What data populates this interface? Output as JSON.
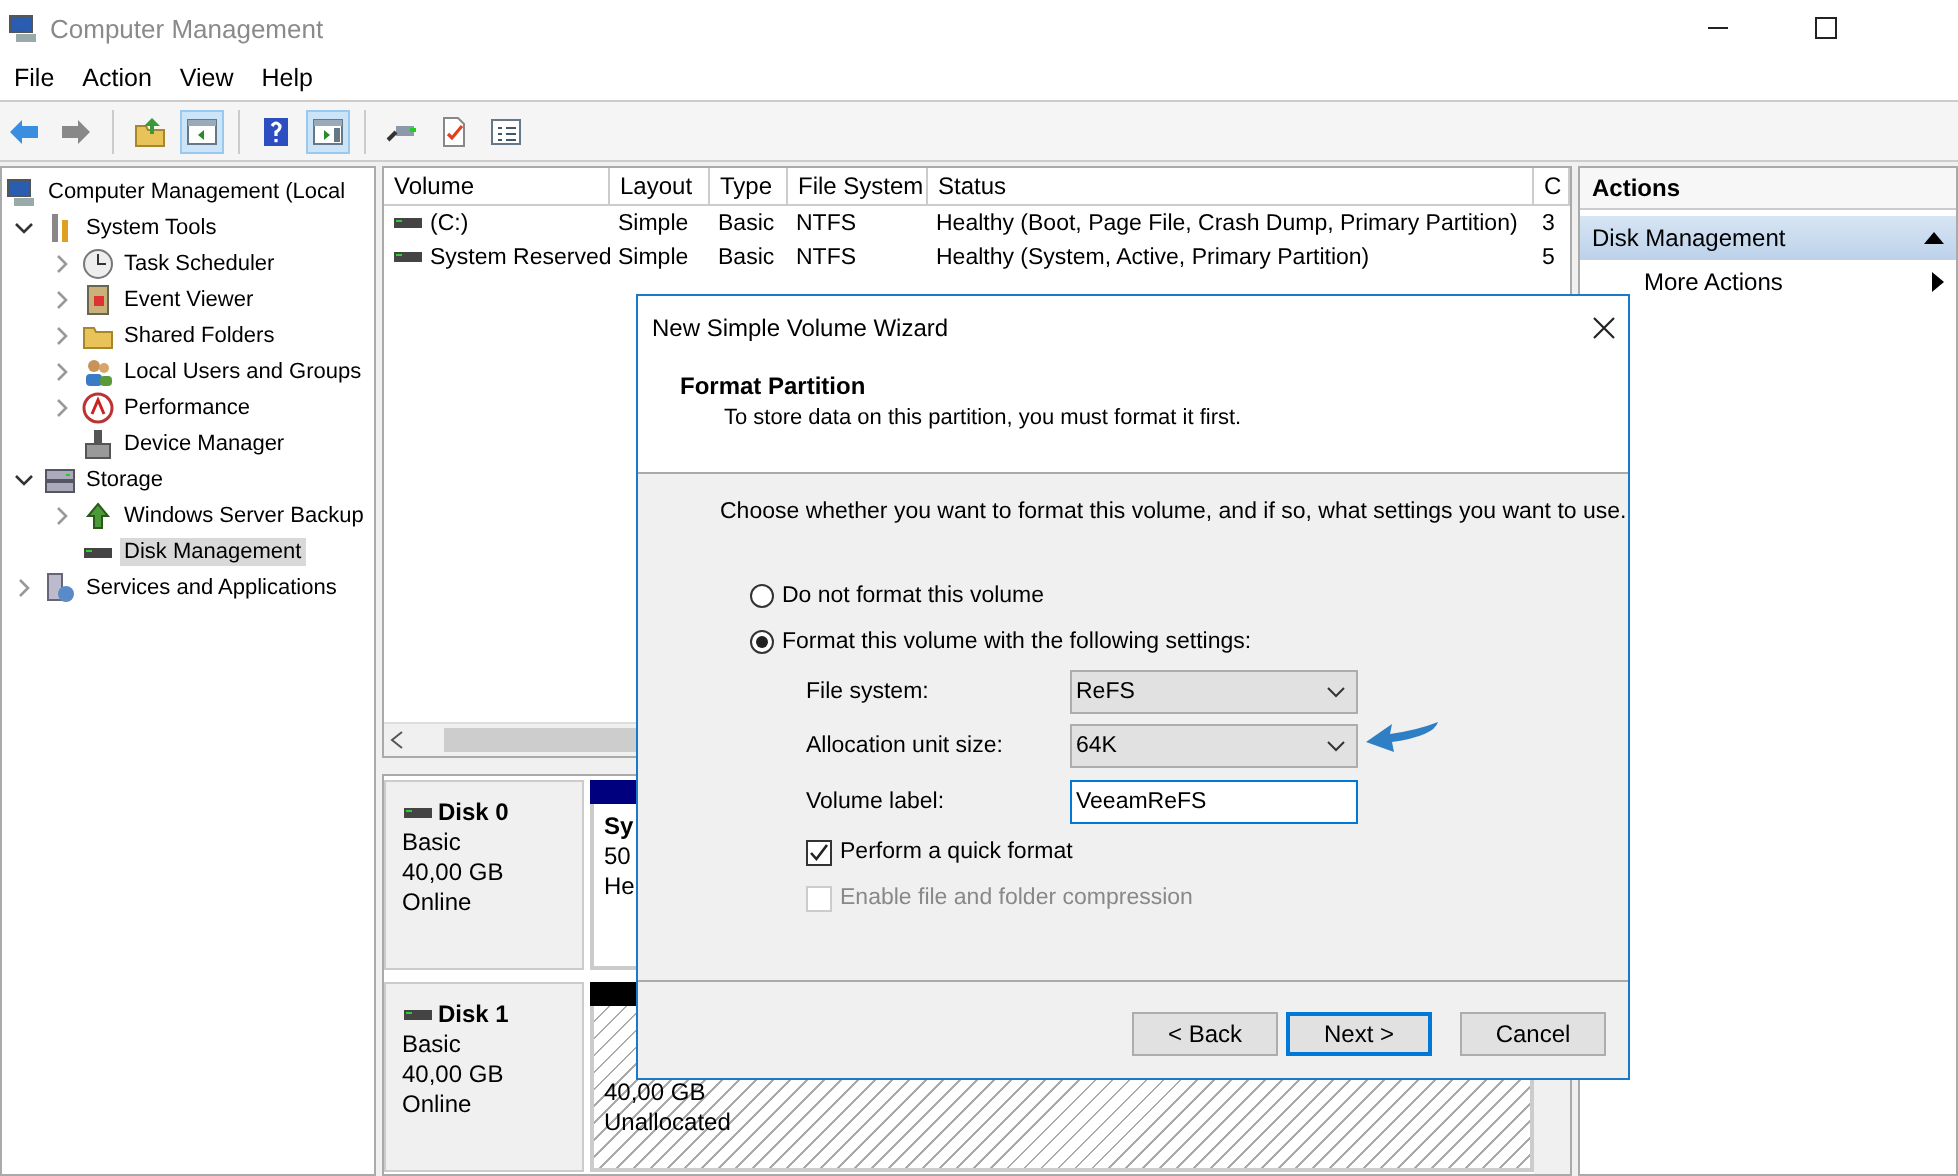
{
  "window": {
    "title": "Computer Management"
  },
  "menu": [
    "File",
    "Action",
    "View",
    "Help"
  ],
  "tree": [
    {
      "label": "Computer Management (Local",
      "selected": false,
      "children": [
        {
          "label": "System Tools",
          "expanded": true,
          "selected": false,
          "children": [
            {
              "label": "Task Scheduler",
              "expanded": false,
              "selected": false
            },
            {
              "label": "Event Viewer",
              "expanded": false,
              "selected": false
            },
            {
              "label": "Shared Folders",
              "expanded": false,
              "selected": false
            },
            {
              "label": "Local Users and Groups",
              "expanded": false,
              "selected": false
            },
            {
              "label": "Performance",
              "expanded": false,
              "selected": false
            },
            {
              "label": "Device Manager",
              "selected": false
            }
          ]
        },
        {
          "label": "Storage",
          "expanded": true,
          "selected": false,
          "children": [
            {
              "label": "Windows Server Backup",
              "expanded": false,
              "selected": false
            },
            {
              "label": "Disk Management",
              "selected": true
            }
          ]
        },
        {
          "label": "Services and Applications",
          "expanded": false,
          "selected": false
        }
      ]
    }
  ],
  "volumes": {
    "columns": [
      "Volume",
      "Layout",
      "Type",
      "File System",
      "Status",
      "C"
    ],
    "rows": [
      [
        "(C:)",
        "Simple",
        "Basic",
        "NTFS",
        "Healthy (Boot, Page File, Crash Dump, Primary Partition)",
        "3"
      ],
      [
        "System Reserved",
        "Simple",
        "Basic",
        "NTFS",
        "Healthy (System, Active, Primary Partition)",
        "5"
      ]
    ]
  },
  "disks": [
    {
      "name": "Disk 0",
      "type": "Basic",
      "size": "40,00 GB",
      "status": "Online",
      "partition": {
        "kind": "primary",
        "lines": [
          "Sy",
          "50",
          "He"
        ]
      }
    },
    {
      "name": "Disk 1",
      "type": "Basic",
      "size": "40,00 GB",
      "status": "Online",
      "partition": {
        "kind": "unallocated",
        "lines": [
          "40,00 GB",
          "Unallocated"
        ]
      }
    }
  ],
  "actions": {
    "title": "Actions",
    "section": "Disk Management",
    "expanded": true,
    "items": [
      "More Actions"
    ]
  },
  "wizard": {
    "title": "New Simple Volume Wizard",
    "heading": "Format Partition",
    "subheading": "To store data on this partition, you must format it first.",
    "prompt": "Choose whether you want to format this volume, and if so, what settings you want to use.",
    "options": [
      {
        "label": "Do not format this volume",
        "selected": false
      },
      {
        "label": "Format this volume with the following settings:",
        "selected": true
      }
    ],
    "fields": [
      {
        "kind": "dropdown",
        "label": "File system:",
        "value": "ReFS"
      },
      {
        "kind": "dropdown",
        "label": "Allocation unit size:",
        "value": "64K"
      },
      {
        "kind": "text",
        "label": "Volume label:",
        "value": "VeeamReFS"
      }
    ],
    "checkboxes": [
      {
        "label": "Perform a quick format",
        "checked": true,
        "disabled": false
      },
      {
        "label": "Enable file and folder compression",
        "checked": false,
        "disabled": true
      }
    ],
    "buttons": [
      {
        "label": "< Back",
        "default": false
      },
      {
        "label": "Next >",
        "default": true
      },
      {
        "label": "Cancel",
        "default": false
      }
    ]
  }
}
